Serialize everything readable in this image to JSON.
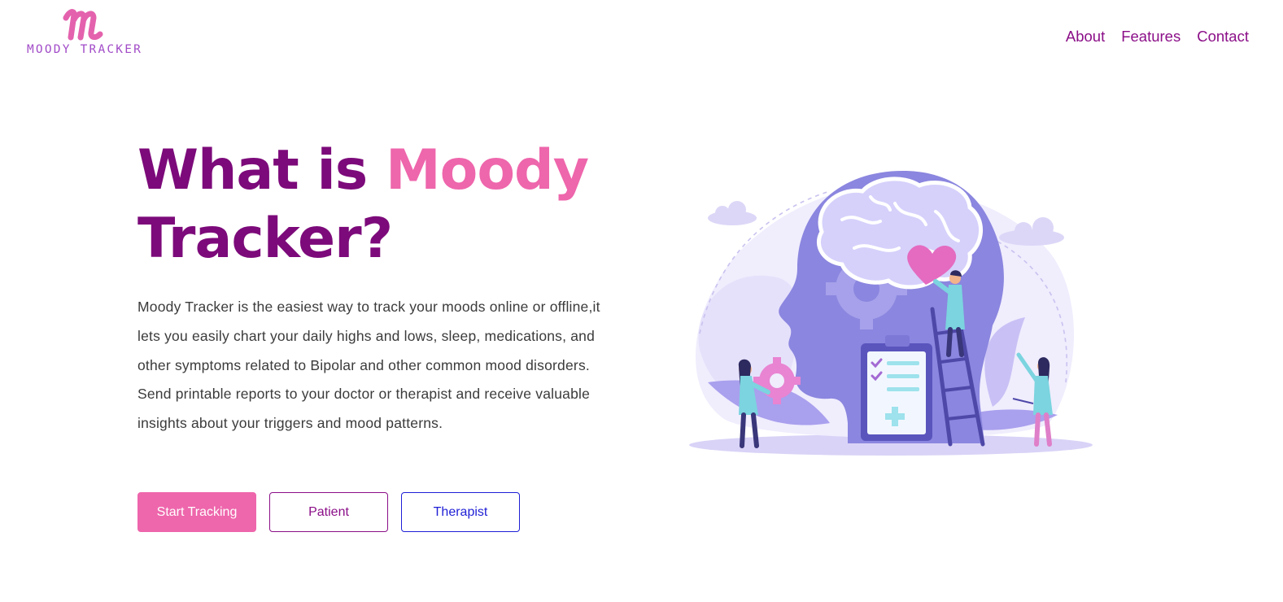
{
  "brand": {
    "logo_text": "MOODY TRACKER",
    "colors": {
      "pink": "#ee66ac",
      "purple": "#7c0a7a",
      "blue": "#1f1fd6"
    }
  },
  "nav": {
    "items": [
      {
        "label": "About"
      },
      {
        "label": "Features"
      },
      {
        "label": "Contact"
      }
    ]
  },
  "hero": {
    "title_part1": "What is ",
    "title_accent": "Moody",
    "title_part2": "Tracker?",
    "description": "Moody Tracker is the easiest way to track your moods online or offline,it lets you easily chart your daily highs and lows, sleep, medications, and other symptoms related to Bipolar and other common mood disorders. Send printable reports to your doctor or therapist and receive valuable insights about your triggers and mood patterns.",
    "buttons": {
      "start": "Start Tracking",
      "patient": "Patient",
      "therapist": "Therapist"
    }
  },
  "illustration": {
    "icon": "brain-mental-health-illustration"
  }
}
